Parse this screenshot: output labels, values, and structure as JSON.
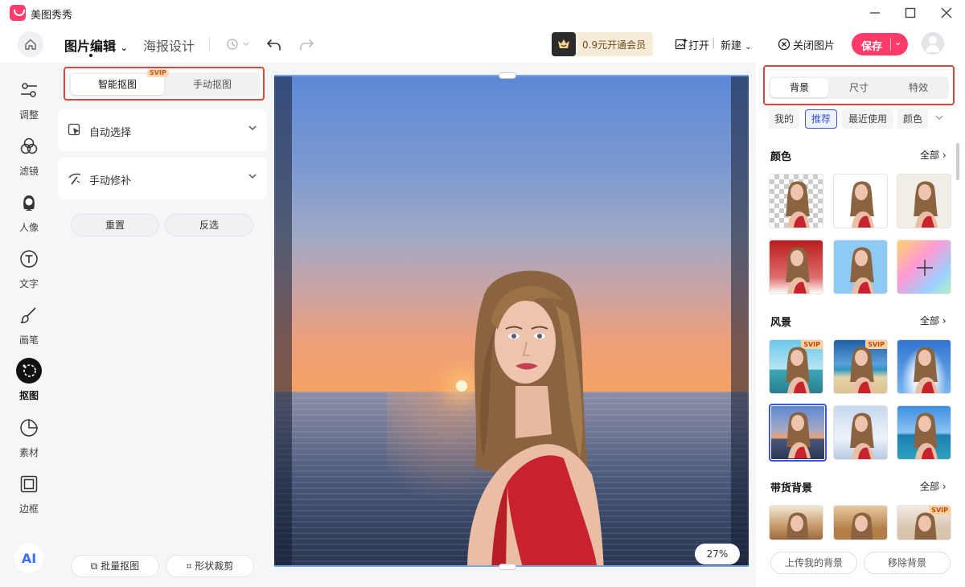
{
  "app": {
    "name": "美图秀秀"
  },
  "toolbar": {
    "tab_photo": "图片编辑",
    "tab_poster": "海报设计",
    "vip_offer": "0.9元开通会员",
    "open": "打开",
    "new": "新建",
    "close_image": "关闭图片",
    "save": "保存"
  },
  "rail": {
    "items": [
      {
        "label": "调整",
        "icon": "sliders-icon"
      },
      {
        "label": "滤镜",
        "icon": "filter-circles-icon"
      },
      {
        "label": "人像",
        "icon": "portrait-icon"
      },
      {
        "label": "文字",
        "icon": "text-icon"
      },
      {
        "label": "画笔",
        "icon": "brush-icon"
      },
      {
        "label": "抠图",
        "icon": "cutout-icon",
        "active": true
      },
      {
        "label": "素材",
        "icon": "sticker-icon"
      },
      {
        "label": "边框",
        "icon": "frame-icon"
      }
    ],
    "ai_label": "AI"
  },
  "left_panel": {
    "seg_smart": "智能抠图",
    "seg_manual": "手动抠图",
    "svip": "SVIP",
    "auto_select": "自动选择",
    "manual_fix": "手动修补",
    "reset": "重置",
    "invert": "反选",
    "batch_cutout": "批量抠图",
    "shape_crop": "形状裁剪"
  },
  "canvas": {
    "zoom": "27%"
  },
  "right_panel": {
    "tabs": [
      "背景",
      "尺寸",
      "特效"
    ],
    "chips": [
      "我的",
      "推荐",
      "最近使用",
      "颜色"
    ],
    "section_color": "颜色",
    "section_scenery": "风景",
    "section_goods": "带货背景",
    "all": "全部",
    "svip": "SVIP",
    "upload_bg": "上传我的背景",
    "remove_bg": "移除背景",
    "color_thumbs": [
      "transparent",
      "#ffffff",
      "#f2ede6",
      "red-gradient",
      "#8fcaf5",
      "rainbow"
    ],
    "scenery_thumbs": [
      "beach-pier",
      "beach-sand",
      "sky-clouds",
      "sunset-sea",
      "sky-light",
      "coast-blue"
    ],
    "goods_thumbs": [
      "room-wood",
      "room-warm",
      "room-bright"
    ]
  },
  "colors": {
    "accent": "#ff3b6a",
    "highlight_border": "#e0443a",
    "selection": "#3b56d8"
  }
}
